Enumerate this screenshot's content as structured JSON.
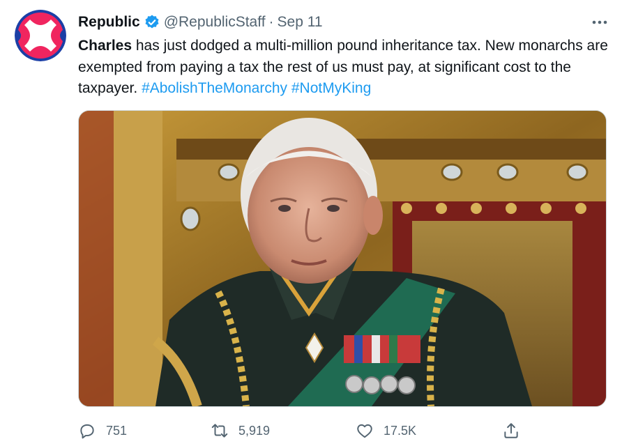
{
  "tweet": {
    "author_name": "Republic",
    "handle": "@RepublicStaff",
    "separator": "·",
    "date": "Sep 11",
    "text": {
      "lead_bold": "Charles",
      "body": " has just dodged a multi-million pound inheritance tax. New monarchs are exempted from paying a tax the rest of us must pay, at significant cost to the taxpayer. ",
      "hashtags": [
        "#AbolishTheMonarchy",
        "#NotMyKing"
      ]
    },
    "actions": {
      "replies": "751",
      "retweets": "5,919",
      "likes": "17.5K"
    }
  },
  "colors": {
    "accent": "#1d9bf0",
    "muted": "#536471",
    "avatar_pink": "#f0255f",
    "avatar_blue": "#1b3fa6"
  },
  "icons": {
    "avatar": "republic-logo",
    "verified": "verified-badge-icon",
    "more": "more-options-icon",
    "reply": "reply-icon",
    "retweet": "retweet-icon",
    "like": "heart-icon",
    "share": "share-icon"
  }
}
